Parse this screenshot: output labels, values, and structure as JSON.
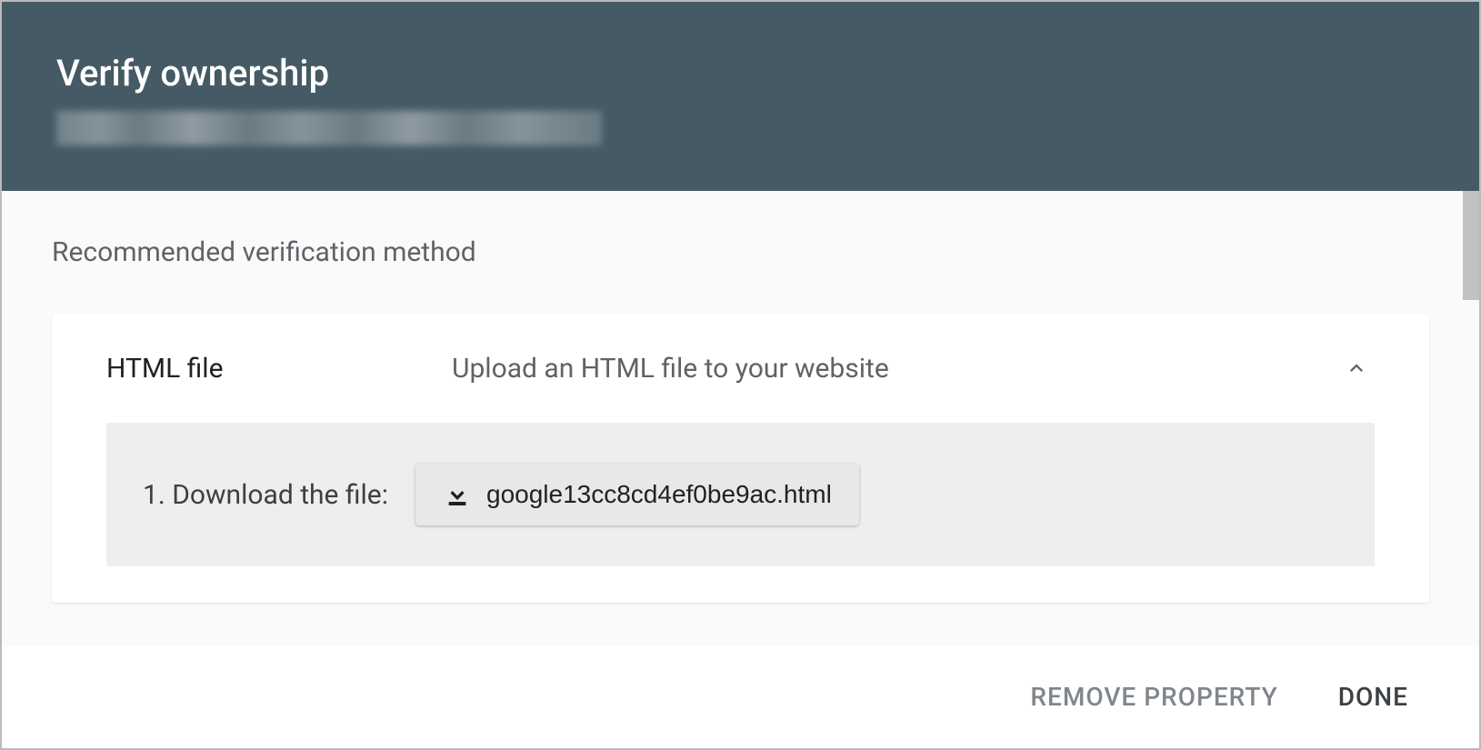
{
  "header": {
    "title": "Verify ownership"
  },
  "section_label": "Recommended verification method",
  "method": {
    "name": "HTML file",
    "description": "Upload an HTML file to your website",
    "step1_label": "1. Download the file:",
    "download_filename": "google13cc8cd4ef0be9ac.html"
  },
  "footer": {
    "remove_label": "REMOVE PROPERTY",
    "done_label": "DONE"
  }
}
